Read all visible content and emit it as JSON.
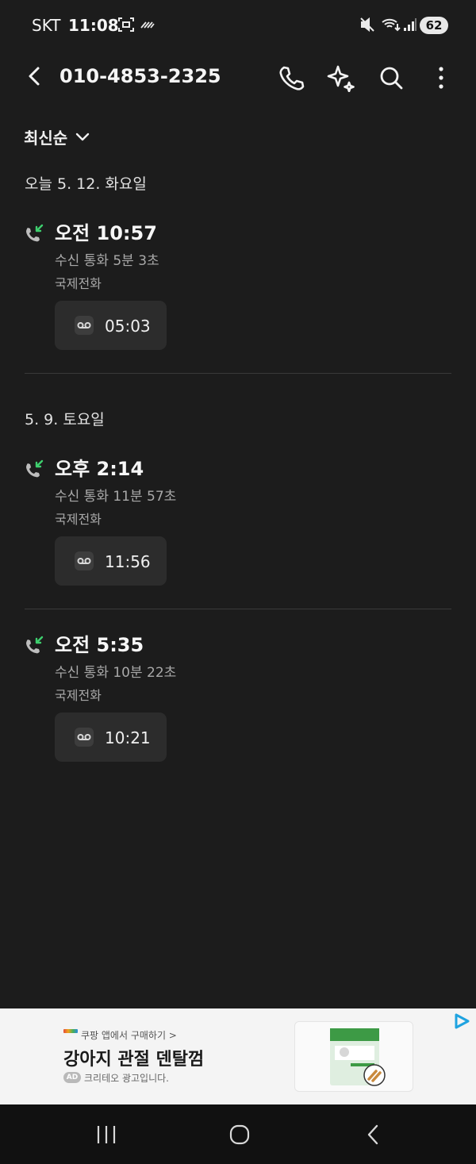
{
  "status_bar": {
    "carrier": "SKT",
    "time": "11:08",
    "battery": "62",
    "icons": [
      "screenshot-icon",
      "nfc-icon",
      "mute-icon",
      "wifi-icon",
      "signal-icon",
      "battery-icon"
    ]
  },
  "header": {
    "title": "010-4853-2325",
    "actions": [
      "back-icon",
      "call-icon",
      "sparkle-icon",
      "search-icon",
      "more-icon"
    ]
  },
  "sort": {
    "label": "최신순"
  },
  "sections": [
    {
      "date": "오늘 5. 12. 화요일",
      "entries": [
        {
          "time": "오전 10:57",
          "desc": "수신 통화 5분 3초",
          "type": "국제전화",
          "recording": "05:03"
        }
      ]
    },
    {
      "date": "5. 9. 토요일",
      "entries": [
        {
          "time": "오후 2:14",
          "desc": "수신 통화 11분 57초",
          "type": "국제전화",
          "recording": "11:56"
        },
        {
          "time": "오전 5:35",
          "desc": "수신 통화 10분 22초",
          "type": "국제전화",
          "recording": "10:21"
        }
      ]
    }
  ],
  "ad": {
    "source": "쿠팡 앱에서 구매하기 >",
    "title": "강아지 관절 덴탈껌",
    "badge": "AD",
    "note": "크리테오 광고입니다."
  },
  "colors": {
    "background": "#1c1c1c",
    "incoming_call_accent": "#3ecf6e",
    "card": "#2c2c2c"
  }
}
